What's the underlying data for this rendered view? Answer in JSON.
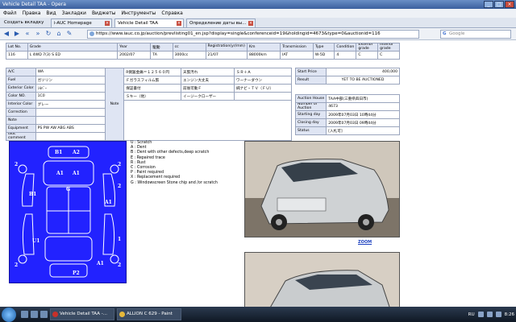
{
  "window": {
    "title": "Vehicle Detail TAA - Opera",
    "controls": [
      "_",
      "□",
      "×"
    ]
  },
  "menu": [
    "Файл",
    "Правка",
    "Вид",
    "Закладки",
    "Виджеты",
    "Инструменты",
    "Справка"
  ],
  "tabs": [
    {
      "label": "Создать вкладку"
    },
    {
      "label": "i-AUC Homepage"
    },
    {
      "label": "Vehicle Detail TAA"
    },
    {
      "label": "Определение даты вы..."
    }
  ],
  "address": {
    "url": "https://www.iauc.co.jp/auction/prevlisting01_en.jsp?display=single&conferenceid=19&holdingid=4673&type=0&auctionid=116",
    "search_placeholder": "Google"
  },
  "lot_table": {
    "headers": [
      "Lot No.",
      "Grade",
      "Year",
      "駆動",
      "cc",
      "Registration(yr/mm)",
      "Km",
      "Transmission",
      "Type",
      "Condition",
      "Exterior grade",
      "Interior grade"
    ],
    "values": [
      "116",
      "L 4WD 7(3) S ED",
      "2002/07",
      "TA",
      "3000cc",
      "21/07",
      "88000km",
      "IAT",
      "W-5D",
      "4",
      "C",
      "C"
    ]
  },
  "spec_table": {
    "rows": [
      {
        "label": "A/C",
        "value": "WA"
      },
      {
        "label": "Fuel",
        "value": "ガソリン"
      },
      {
        "label": "Exterior Color",
        "value": "ｼﾙﾊﾞｰ"
      },
      {
        "label": "Color NO.",
        "value": "1C0"
      },
      {
        "label": "Interior Color",
        "value": "グレー"
      },
      {
        "label": "Correction",
        "value": ""
      },
      {
        "label": "Note",
        "value": ""
      },
      {
        "label": "Equipment",
        "value": "PS PW AW ABG ABS"
      },
      {
        "label": "iauc comment",
        "value": ""
      }
    ],
    "note_label": "Note",
    "note_cells": [
      [
        "R側鈑金痛＝１２５６０円",
        "天張汚れ",
        "ＳＲ＋Ａ"
      ],
      [
        "Ｆガラスフィルム張",
        "エンジン大丈夫",
        "ワーナーダウン"
      ],
      [
        "保証書付",
        "前後可動Ｆ",
        "純ナビ・ＴＶ（ＦＵ）"
      ],
      [
        "Ｓキー（他）",
        "イージークローザー",
        ""
      ]
    ]
  },
  "price_table": {
    "start_price_label": "Start Price",
    "start_price": "400,000",
    "result_label": "Result",
    "result": "YET TO BE AUCTIONED"
  },
  "auction_table": {
    "rows": [
      {
        "label": "Auction House",
        "value": "TAA中部(三重県四日市)"
      },
      {
        "label": "Number of Auction",
        "value": "4673"
      },
      {
        "label": "Starting day",
        "value": "2009年07月03日 10時44分"
      },
      {
        "label": "Closing day",
        "value": "2009年07月03日 09時44分"
      },
      {
        "label": "Status",
        "value": "[入札可]"
      }
    ]
  },
  "damage_map": {
    "marks": [
      "B1",
      "A2",
      "2",
      "A1",
      "A1",
      "2",
      "2",
      "G",
      "B1",
      "A1",
      "U1",
      "P2",
      "1",
      "2",
      "2",
      "A1"
    ]
  },
  "legend": [
    "U : Scratch",
    "A : Dent",
    "B : Dent with other defects,deep scratch",
    "E : Repaired trace",
    "R : Rust",
    "C : Corrosion",
    "P : Paint required",
    "X : Replacement required",
    "G : Windowscreen Stone chip and /or scratch"
  ],
  "zoom_label": "ZOOM",
  "taskbar": {
    "tasks": [
      "Vehicle Detail TAA -...",
      "ALLION C 629 - Paint"
    ],
    "lang": "RU",
    "time": "8:26"
  },
  "colors": {
    "damage_bg": "#2222ff",
    "header_bg": "#dfe5f3"
  }
}
